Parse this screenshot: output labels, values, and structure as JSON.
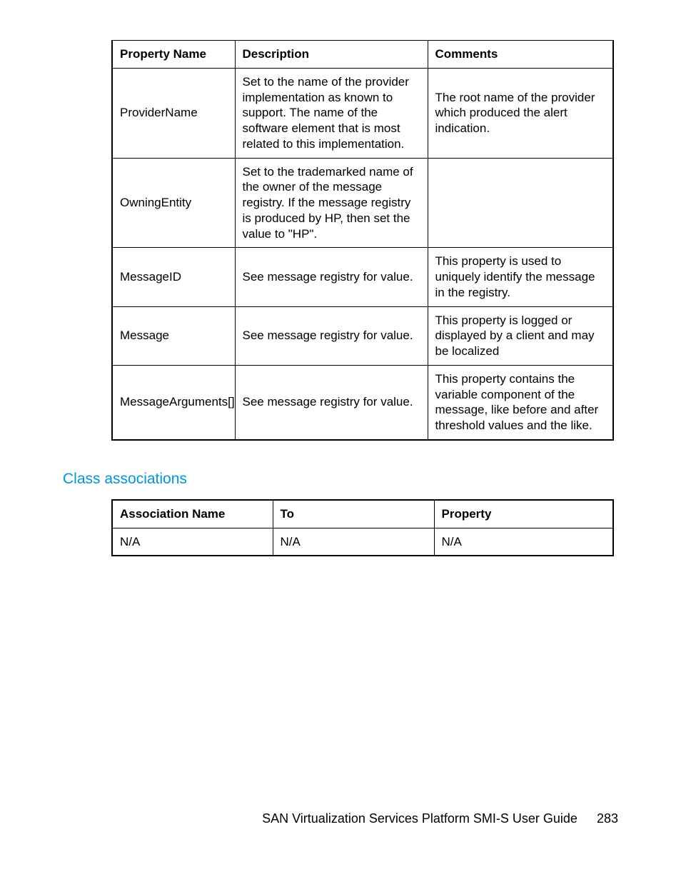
{
  "table1": {
    "headers": [
      "Property Name",
      "Description",
      "Comments"
    ],
    "rows": [
      {
        "prop": "ProviderName",
        "desc": "Set to the name of the provider implementation as known to support. The name of the software element that is most related to this implementation.",
        "comm": "The root name of the provider which produced the alert indication."
      },
      {
        "prop": "OwningEntity",
        "desc": "Set to the trademarked name of the owner of the message registry. If the message registry is produced by HP, then set the value to \"HP\".",
        "comm": ""
      },
      {
        "prop": "MessageID",
        "desc": "See message registry for value.",
        "comm": "This property is used to uniquely identify the message in the registry."
      },
      {
        "prop": "Message",
        "desc": "See message registry for value.",
        "comm": "This property is logged or displayed by a client and may be localized"
      },
      {
        "prop": "MessageArguments[]",
        "desc": "See message registry for value.",
        "comm": "This property contains the variable component of the message, like before and after threshold values and the like."
      }
    ]
  },
  "section_heading": "Class associations",
  "table2": {
    "headers": [
      "Association Name",
      "To",
      "Property"
    ],
    "rows": [
      {
        "assoc": "N/A",
        "to": "N/A",
        "prop": "N/A"
      }
    ]
  },
  "footer": {
    "title": "SAN Virtualization Services Platform SMI-S User Guide",
    "page": "283"
  }
}
